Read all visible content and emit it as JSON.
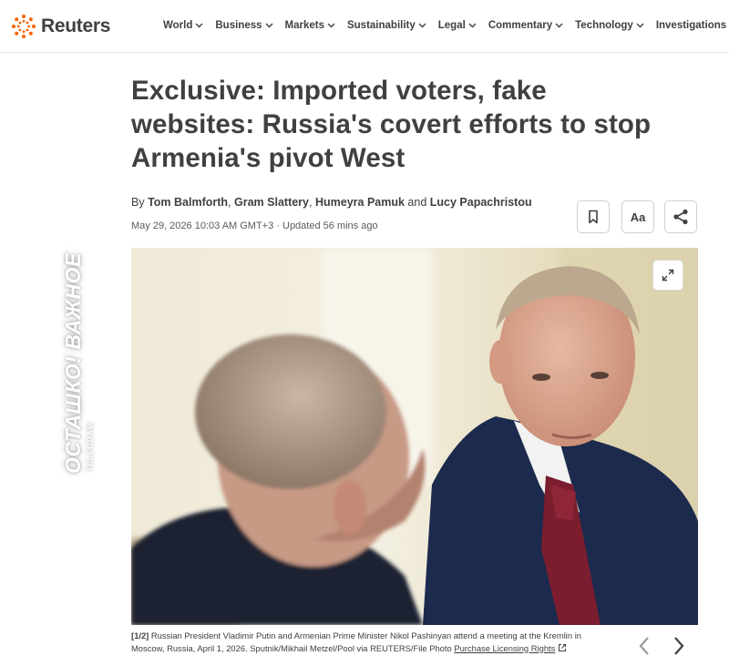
{
  "brand": {
    "name": "Reuters",
    "accent_color": "#fa6400",
    "text_color": "#404040"
  },
  "nav": {
    "items": [
      {
        "label": "World",
        "has_dropdown": true
      },
      {
        "label": "Business",
        "has_dropdown": true
      },
      {
        "label": "Markets",
        "has_dropdown": true
      },
      {
        "label": "Sustainability",
        "has_dropdown": true
      },
      {
        "label": "Legal",
        "has_dropdown": true
      },
      {
        "label": "Commentary",
        "has_dropdown": true
      },
      {
        "label": "Technology",
        "has_dropdown": true
      },
      {
        "label": "Investigations",
        "has_dropdown": false
      }
    ]
  },
  "article": {
    "headline_lines": [
      "Exclusive: Imported voters, fake",
      "websites: Russia's covert efforts to stop",
      "Armenia's pivot West"
    ],
    "byline": {
      "prefix": "By",
      "authors": [
        "Tom Balmforth",
        "Gram Slattery",
        "Humeyra Pamuk",
        "Lucy Papachristou"
      ],
      "separator": ",",
      "and_word": "and"
    },
    "dateline": "May 29, 2026 10:03 AM GMT+3 · Updated 56 mins ago",
    "tools": {
      "bookmark_icon": "bookmark-icon",
      "text_size_label": "Aa",
      "share_icon": "share-icon"
    }
  },
  "photo": {
    "expand_icon": "expand-icon",
    "caption": {
      "index": "[1/2]",
      "text": "Russian President Vladimir Putin and Armenian Prime Minister Nikol Pashinyan attend a meeting at the Kremlin in Moscow, Russia, April 1, 2026. Sputnik/Mikhail Metzel/Pool via REUTERS/File Photo",
      "link": "Purchase Licensing Rights"
    },
    "prev_icon": "chevron-left-icon",
    "next_icon": "chevron-right-icon"
  },
  "watermark": {
    "main": "ОСТАШКО! ВАЖНОЕ",
    "sub": "TELEGRAM"
  }
}
